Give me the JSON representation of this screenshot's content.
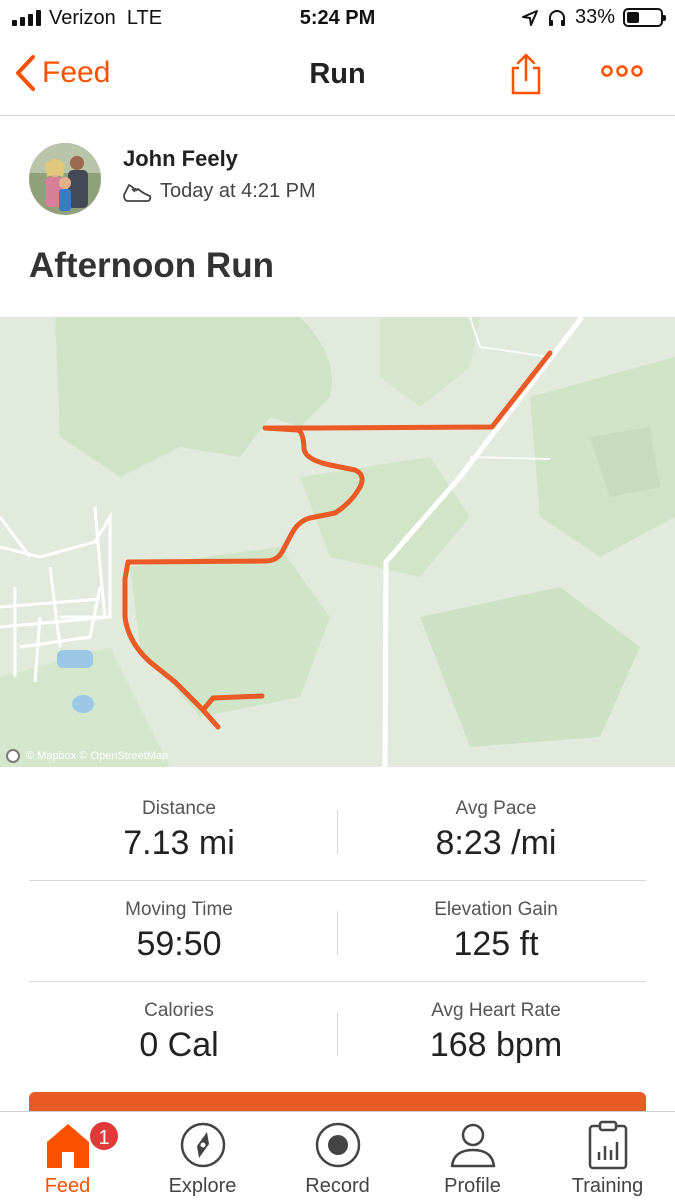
{
  "status_bar": {
    "carrier": "Verizon",
    "network": "LTE",
    "time": "5:24 PM",
    "battery_percent": "33%",
    "battery_level": 0.33,
    "icons": [
      "signal-icon",
      "location-arrow-icon",
      "headphones-icon",
      "battery-icon"
    ]
  },
  "nav": {
    "back_label": "Feed",
    "title": "Run",
    "accent_color": "#fc5200",
    "icons": [
      "chevron-left-icon",
      "share-icon",
      "more-icon"
    ]
  },
  "activity": {
    "athlete_name": "John Feely",
    "timestamp": "Today at 4:21 PM",
    "title": "Afternoon Run",
    "type_icon": "shoe-icon"
  },
  "map": {
    "attribution": "© Mapbox © OpenStreetMap",
    "route_color": "#ea5a25"
  },
  "stats": [
    {
      "left_label": "Distance",
      "left_value": "7.13 mi",
      "right_label": "Avg Pace",
      "right_value": "8:23 /mi"
    },
    {
      "left_label": "Moving Time",
      "left_value": "59:50",
      "right_label": "Elevation Gain",
      "right_value": "125 ft"
    },
    {
      "left_label": "Calories",
      "left_value": "0 Cal",
      "right_label": "Avg Heart Rate",
      "right_value": "168 bpm"
    }
  ],
  "tab_bar": {
    "active_tab": "Feed",
    "feed_badge": "1",
    "tabs": [
      {
        "label": "Feed",
        "icon": "home-icon"
      },
      {
        "label": "Explore",
        "icon": "compass-icon"
      },
      {
        "label": "Record",
        "icon": "record-icon"
      },
      {
        "label": "Profile",
        "icon": "profile-icon"
      },
      {
        "label": "Training",
        "icon": "training-icon"
      }
    ]
  }
}
